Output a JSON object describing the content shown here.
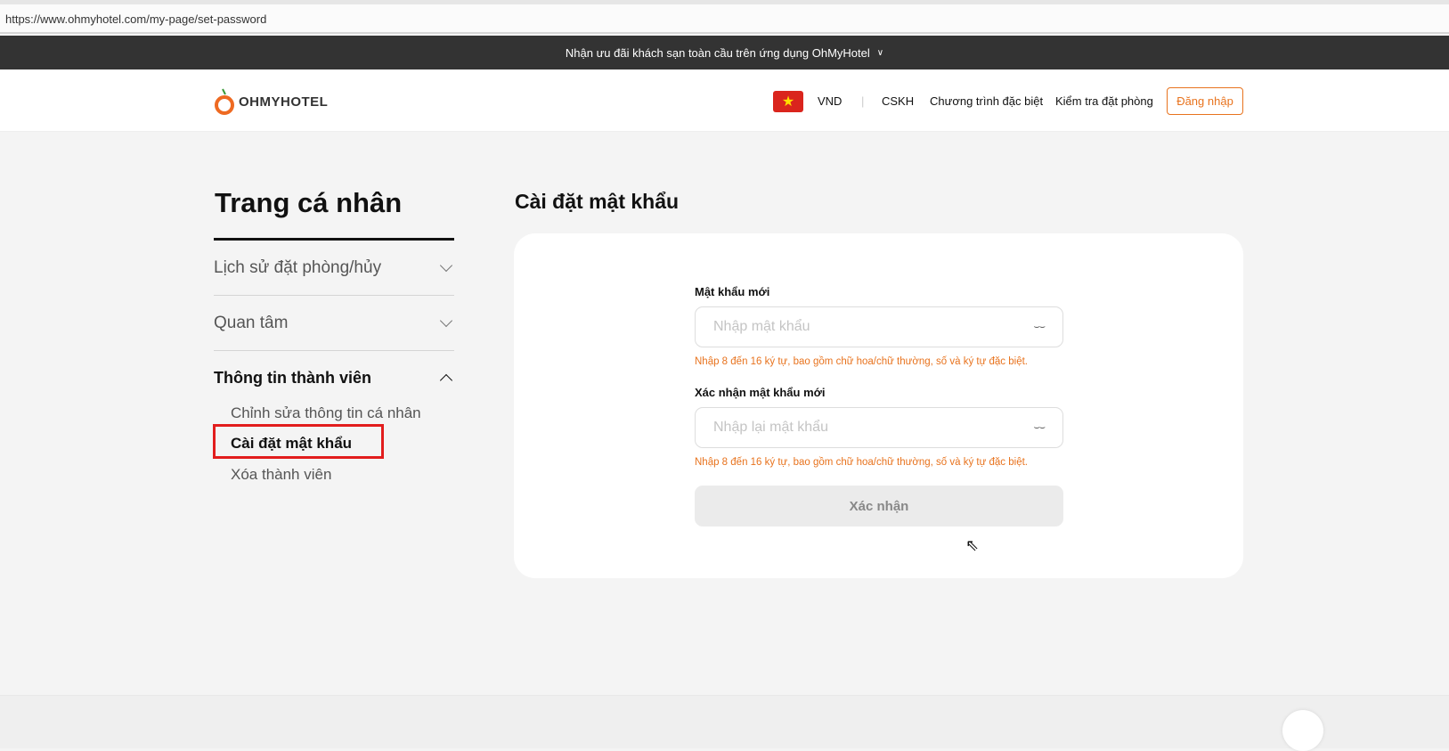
{
  "browser": {
    "url": "https://www.ohmyhotel.com/my-page/set-password"
  },
  "promo": {
    "text": "Nhận ưu đãi khách sạn toàn cầu trên ứng dụng OhMyHotel"
  },
  "header": {
    "logo": "OHMYHOTEL",
    "currency": "VND",
    "nav": [
      "CSKH",
      "Chương trình đặc biệt",
      "Kiểm tra đặt phòng"
    ],
    "login": "Đăng nhập"
  },
  "sidebar": {
    "title": "Trang cá nhân",
    "sections": [
      {
        "label": "Lịch sử đặt phòng/hủy"
      },
      {
        "label": "Quan tâm"
      },
      {
        "label": "Thông tin thành viên"
      }
    ],
    "subitems": [
      "Chỉnh sửa thông tin cá nhân",
      "Cài đặt mật khẩu",
      "Xóa thành viên"
    ]
  },
  "main": {
    "title": "Cài đặt mật khẩu",
    "fields": [
      {
        "label": "Mật khẩu mới",
        "placeholder": "Nhập mật khẩu",
        "hint": "Nhập 8 đến 16 ký tự, bao gồm chữ hoa/chữ thường, số và ký tự đặc biệt."
      },
      {
        "label": "Xác nhận mật khẩu mới",
        "placeholder": "Nhập lại mật khẩu",
        "hint": "Nhập 8 đến 16 ký tự, bao gồm chữ hoa/chữ thường, số và ký tự đặc biệt."
      }
    ],
    "submit": "Xác nhận"
  },
  "colors": {
    "accent": "#e8731e",
    "highlight": "#e21d1d"
  }
}
